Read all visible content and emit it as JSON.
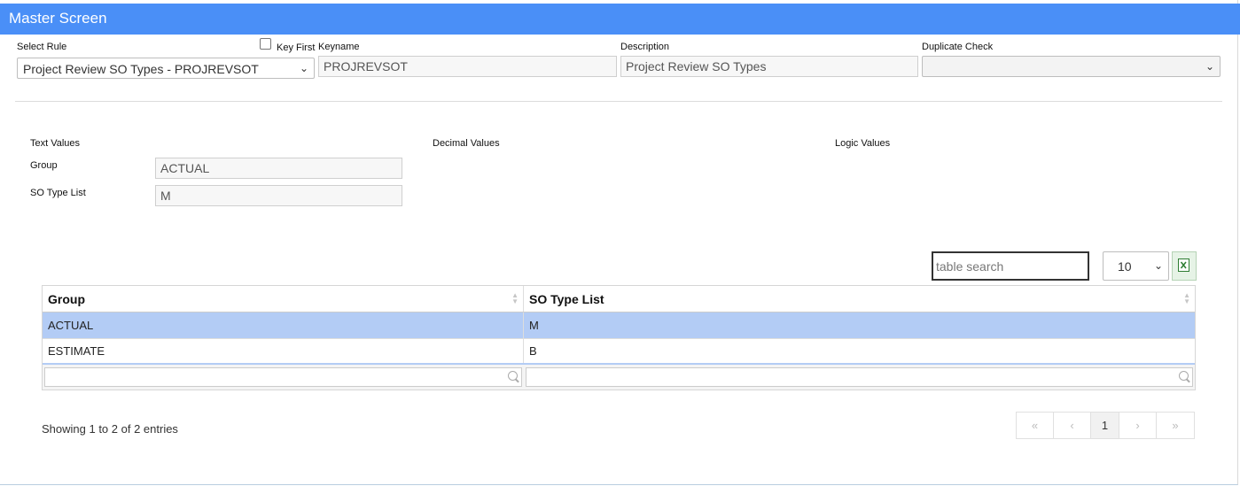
{
  "window": {
    "title": "Master Screen"
  },
  "header": {
    "select_rule_label": "Select Rule",
    "select_rule_value": "Project Review SO Types - PROJREVSOT",
    "key_first_label": "Key First",
    "keyname_label": "Keyname",
    "keyname_value": "PROJREVSOT",
    "description_label": "Description",
    "description_value": "Project Review SO Types",
    "duplicate_check_label": "Duplicate Check",
    "duplicate_check_value": ""
  },
  "sections": {
    "text_values": "Text Values",
    "decimal_values": "Decimal Values",
    "logic_values": "Logic Values"
  },
  "text_fields": [
    {
      "label": "Group",
      "value": "ACTUAL"
    },
    {
      "label": "SO Type List",
      "value": "M"
    }
  ],
  "table": {
    "search_placeholder": "table search",
    "page_size": "10",
    "columns": [
      "Group",
      "SO Type List"
    ],
    "rows": [
      [
        "ACTUAL",
        "M"
      ],
      [
        "ESTIMATE",
        "B"
      ]
    ],
    "selected_row": 0,
    "info": "Showing 1 to 2 of 2 entries",
    "pager": {
      "first": "«",
      "prev": "‹",
      "current": "1",
      "next": "›",
      "last": "»"
    }
  },
  "colors": {
    "titlebar": "#4a8ff7",
    "selected_row": "#b3ccf5"
  }
}
